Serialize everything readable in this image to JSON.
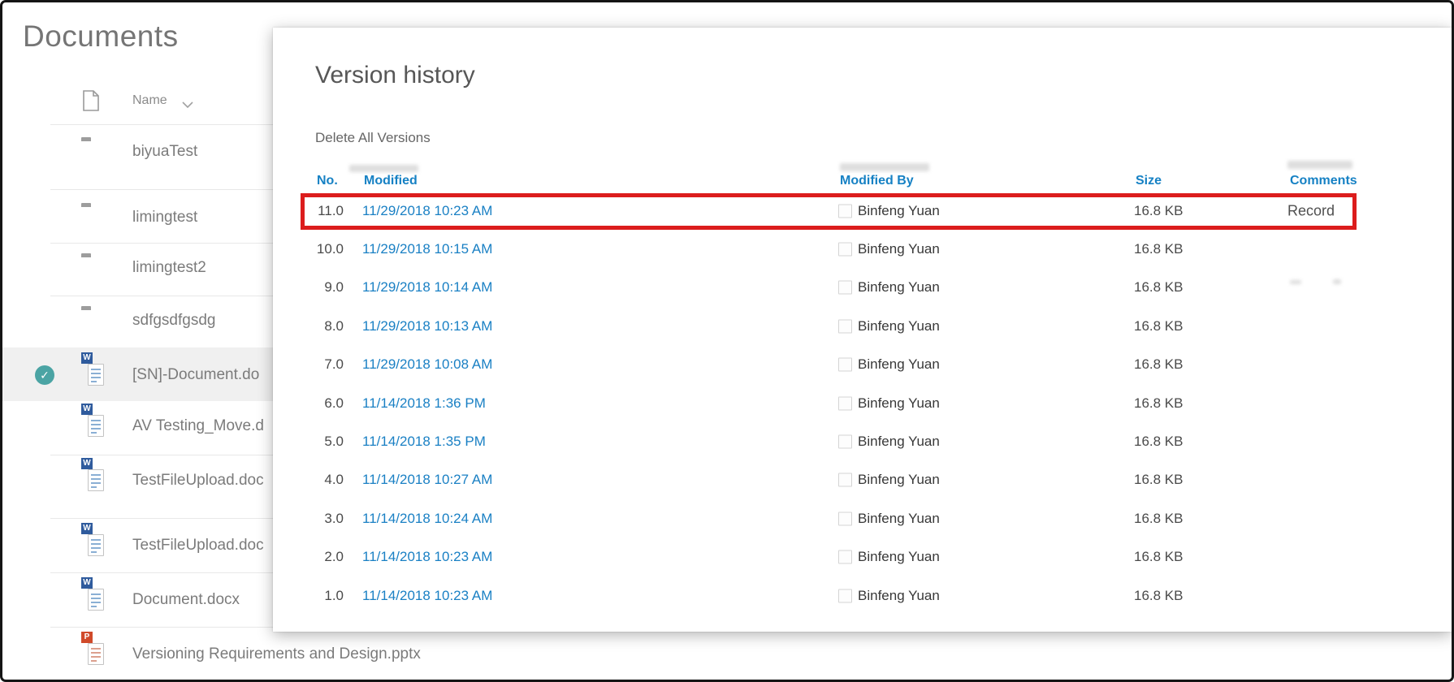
{
  "background": {
    "page_title": "Documents",
    "list": {
      "name_header": "Name",
      "items": [
        {
          "name": "biyuaTest",
          "type": "folder",
          "selected": false
        },
        {
          "name": "limingtest",
          "type": "folder",
          "selected": false
        },
        {
          "name": "limingtest2",
          "type": "folder",
          "selected": false
        },
        {
          "name": "sdfgsdfgsdg",
          "type": "folder",
          "selected": false
        },
        {
          "name": "[SN]-Document.do",
          "type": "word",
          "selected": true
        },
        {
          "name": "AV Testing_Move.d",
          "type": "word",
          "selected": false
        },
        {
          "name": "TestFileUpload.doc",
          "type": "word",
          "selected": false
        },
        {
          "name": "TestFileUpload.doc",
          "type": "word",
          "selected": false
        },
        {
          "name": "Document.docx",
          "type": "word",
          "selected": false
        },
        {
          "name": "Versioning Requirements and Design.pptx",
          "type": "powerpoint",
          "selected": false
        }
      ]
    }
  },
  "dialog": {
    "title": "Version history",
    "delete_all_label": "Delete All Versions",
    "columns": {
      "no": "No.",
      "modified": "Modified",
      "modified_by": "Modified By",
      "size": "Size",
      "comments": "Comments"
    },
    "rows": [
      {
        "no": "11.0",
        "modified": "11/29/2018 10:23 AM",
        "modified_by": "Binfeng Yuan",
        "size": "16.8 KB",
        "comments": "Record",
        "highlighted": true
      },
      {
        "no": "10.0",
        "modified": "11/29/2018 10:15 AM",
        "modified_by": "Binfeng Yuan",
        "size": "16.8 KB",
        "comments": "",
        "highlighted": false
      },
      {
        "no": "9.0",
        "modified": "11/29/2018 10:14 AM",
        "modified_by": "Binfeng Yuan",
        "size": "16.8 KB",
        "comments": "",
        "highlighted": false
      },
      {
        "no": "8.0",
        "modified": "11/29/2018 10:13 AM",
        "modified_by": "Binfeng Yuan",
        "size": "16.8 KB",
        "comments": "",
        "highlighted": false
      },
      {
        "no": "7.0",
        "modified": "11/29/2018 10:08 AM",
        "modified_by": "Binfeng Yuan",
        "size": "16.8 KB",
        "comments": "",
        "highlighted": false
      },
      {
        "no": "6.0",
        "modified": "11/14/2018 1:36 PM",
        "modified_by": "Binfeng Yuan",
        "size": "16.8 KB",
        "comments": "",
        "highlighted": false
      },
      {
        "no": "5.0",
        "modified": "11/14/2018 1:35 PM",
        "modified_by": "Binfeng Yuan",
        "size": "16.8 KB",
        "comments": "",
        "highlighted": false
      },
      {
        "no": "4.0",
        "modified": "11/14/2018 10:27 AM",
        "modified_by": "Binfeng Yuan",
        "size": "16.8 KB",
        "comments": "",
        "highlighted": false
      },
      {
        "no": "3.0",
        "modified": "11/14/2018 10:24 AM",
        "modified_by": "Binfeng Yuan",
        "size": "16.8 KB",
        "comments": "",
        "highlighted": false
      },
      {
        "no": "2.0",
        "modified": "11/14/2018 10:23 AM",
        "modified_by": "Binfeng Yuan",
        "size": "16.8 KB",
        "comments": "",
        "highlighted": false
      },
      {
        "no": "1.0",
        "modified": "11/14/2018 10:23 AM",
        "modified_by": "Binfeng Yuan",
        "size": "16.8 KB",
        "comments": "",
        "highlighted": false
      }
    ],
    "selected_check_icon": "check",
    "colors": {
      "header_blue": "#1681c4",
      "link_blue": "#1a80c4",
      "annotation_red": "#dc1d1d",
      "selected_teal": "#4ba4a4"
    }
  }
}
